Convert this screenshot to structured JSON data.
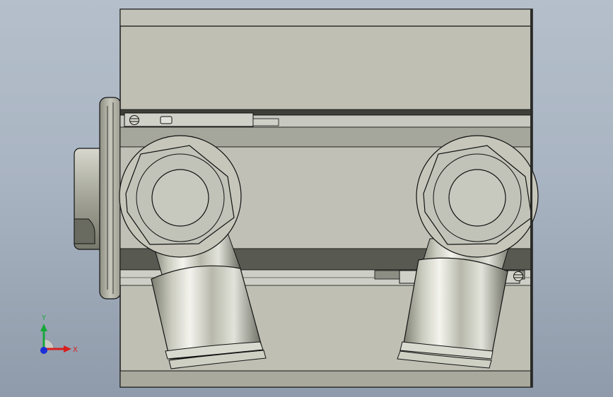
{
  "viewport": {
    "background_top": "#b5bfcb",
    "background_bottom": "#8f9aaa"
  },
  "model": {
    "body_color": "#bfbfb4",
    "edge_color": "#111111",
    "dark_band_color": "#55584f",
    "metal_light": "#e6e7df",
    "metal_dark": "#6c6d62"
  },
  "triad": {
    "x_label": "X",
    "y_label": "Y",
    "x_color": "#d81e1e",
    "y_color": "#18a83a",
    "z_color": "#1c2fd6"
  }
}
